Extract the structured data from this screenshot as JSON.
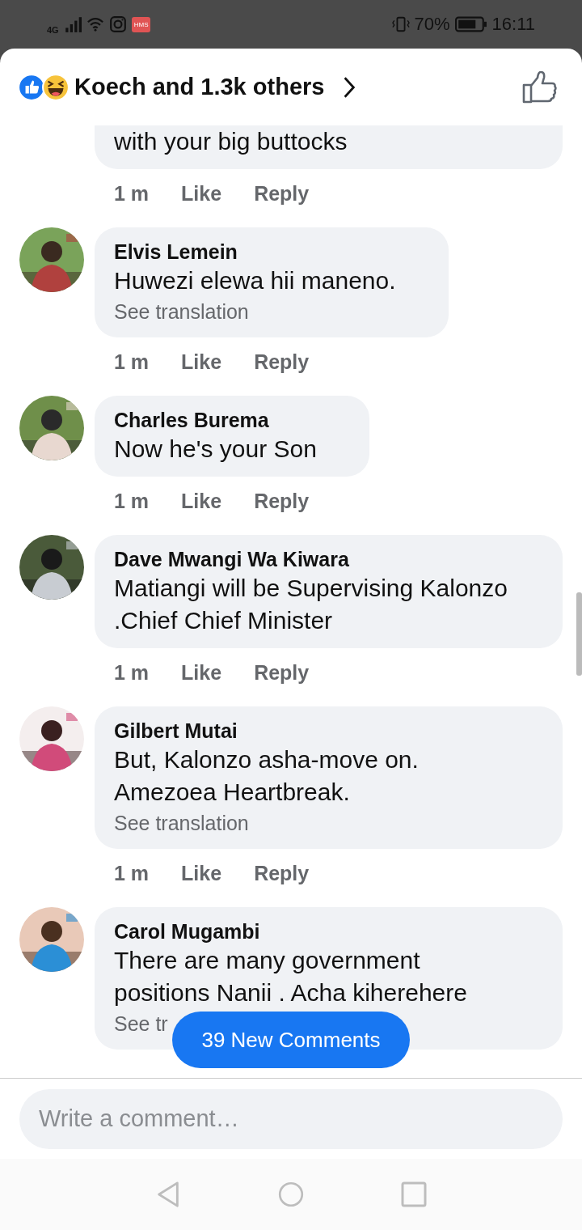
{
  "status_bar": {
    "network": "4G",
    "app_badge": "HMS",
    "battery": "70%",
    "time": "16:11"
  },
  "header": {
    "title": "Koech and 1.3k others"
  },
  "comments": [
    {
      "text": "with your big buttocks",
      "time": "1 m",
      "like": "Like",
      "reply": "Reply"
    },
    {
      "name": "Elvis Lemein",
      "text": "Huwezi elewa hii maneno.",
      "translation": "See translation",
      "time": "1 m",
      "like": "Like",
      "reply": "Reply"
    },
    {
      "name": "Charles Burema",
      "text": "Now he's your Son",
      "time": "1 m",
      "like": "Like",
      "reply": "Reply"
    },
    {
      "name": "Dave Mwangi Wa Kiwara",
      "text": "Matiangi will be Supervising Kalonzo .Chief Chief Minister",
      "time": "1 m",
      "like": "Like",
      "reply": "Reply"
    },
    {
      "name": "Gilbert Mutai",
      "text": "But, Kalonzo asha-move on. Amezoea Heartbreak.",
      "translation": "See translation",
      "time": "1 m",
      "like": "Like",
      "reply": "Reply"
    },
    {
      "name": "Carol Mugambi",
      "text": "There are many government positions Nanii . Acha kiherehere",
      "translation": "See tr"
    }
  ],
  "new_comments_button": "39 New Comments",
  "comment_field": {
    "placeholder": "Write a comment…"
  }
}
